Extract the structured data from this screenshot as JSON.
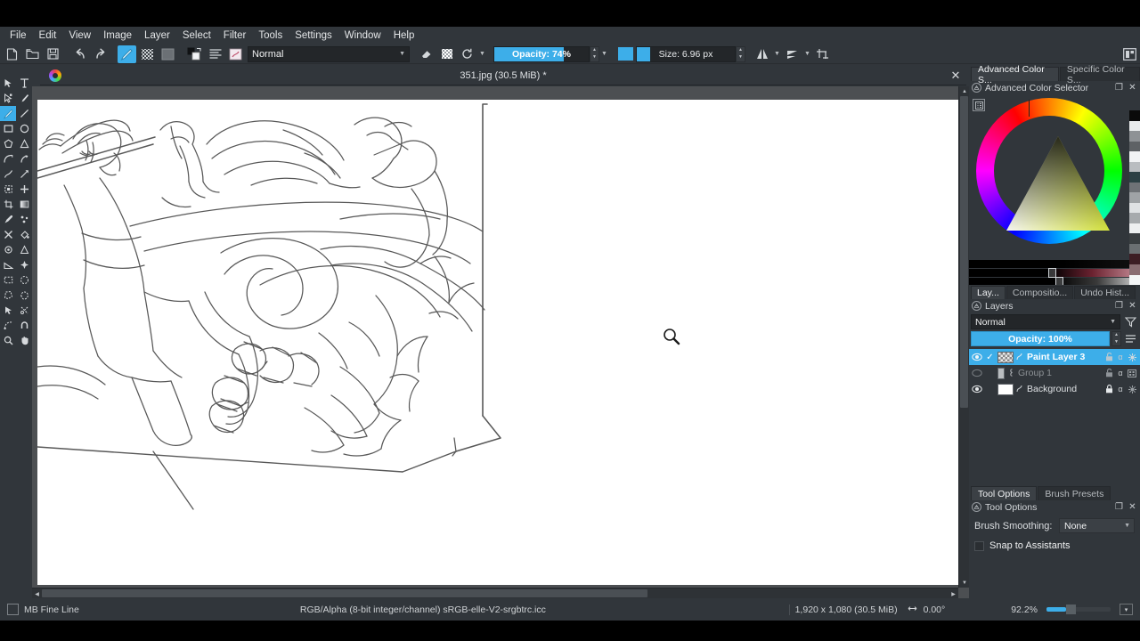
{
  "app": {
    "name": "Krita",
    "accent": "#3daee9",
    "chrome_bg": "#31363b"
  },
  "menubar": {
    "items": [
      "File",
      "Edit",
      "View",
      "Image",
      "Layer",
      "Select",
      "Filter",
      "Tools",
      "Settings",
      "Window",
      "Help"
    ]
  },
  "toolbar": {
    "new_label": "new-document",
    "open_label": "open-document",
    "save_label": "save-document",
    "undo_label": "undo",
    "redo_label": "redo",
    "blend_mode": "Normal",
    "opacity_label": "Opacity:  74%",
    "opacity_value": 74,
    "size_label": "Size: 6.96 px",
    "size_value": 6.96
  },
  "document": {
    "title": "351.jpg (30.5 MiB) *",
    "close_label": "✕"
  },
  "color_selector": {
    "tabs": [
      {
        "label": "Advanced Color S...",
        "active": true
      },
      {
        "label": "Specific Color S...",
        "active": false
      }
    ],
    "title": "Advanced Color Selector",
    "float_label": "❐",
    "close_label": "✕",
    "wheel_hue_deg": 75,
    "triangle_color": "#d9e838"
  },
  "layers_docker": {
    "tabs": [
      {
        "label": "Lay...",
        "active": true
      },
      {
        "label": "Compositio...",
        "active": false
      },
      {
        "label": "Undo Hist...",
        "active": false
      }
    ],
    "title": "Layers",
    "float_label": "❐",
    "close_label": "✕",
    "blend_mode": "Normal",
    "opacity_label": "Opacity:  100%",
    "opacity_value": 100,
    "rows": [
      {
        "name": "Paint Layer 3",
        "visible": true,
        "checked": true,
        "selected": true,
        "kind": "paint",
        "locked": false,
        "alpha_label": "α"
      },
      {
        "name": "Group 1",
        "visible": false,
        "checked": false,
        "selected": false,
        "kind": "group",
        "locked": false,
        "alpha_label": "α"
      },
      {
        "name": "Background",
        "visible": true,
        "checked": false,
        "selected": false,
        "kind": "paint",
        "locked": true,
        "alpha_label": "α"
      }
    ],
    "buttons": [
      "add-layer",
      "duplicate-layer",
      "move-layer-down",
      "move-layer-up",
      "layer-properties",
      "delete-layer"
    ]
  },
  "tool_options": {
    "tabs": [
      {
        "label": "Tool Options",
        "active": true
      },
      {
        "label": "Brush Presets",
        "active": false
      }
    ],
    "title": "Tool Options",
    "float_label": "❐",
    "close_label": "✕",
    "smoothing_label": "Brush Smoothing:",
    "smoothing_value": "None",
    "snap_label": "Snap to Assistants",
    "snap_checked": false
  },
  "statusbar": {
    "brush_preset": "MB Fine Line",
    "color_profile": "RGB/Alpha (8-bit integer/channel)  sRGB-elle-V2-srgbtrc.icc",
    "image_size": "1,920 x 1,080 (30.5 MiB)",
    "rotation": "0.00°",
    "zoom": "92.2%"
  },
  "toolbox": {
    "tools": [
      {
        "name": "select-shapes-tool",
        "selected": false
      },
      {
        "name": "text-tool",
        "selected": false
      },
      {
        "name": "edit-shapes-tool",
        "selected": false
      },
      {
        "name": "calligraphy-tool",
        "selected": false
      },
      {
        "name": "freehand-brush-tool",
        "selected": true
      },
      {
        "name": "line-tool",
        "selected": false
      },
      {
        "name": "rectangle-tool",
        "selected": false
      },
      {
        "name": "ellipse-tool",
        "selected": false
      },
      {
        "name": "polygon-tool",
        "selected": false
      },
      {
        "name": "polyline-tool",
        "selected": false
      },
      {
        "name": "bezier-curve-tool",
        "selected": false
      },
      {
        "name": "freehand-path-tool",
        "selected": false
      },
      {
        "name": "dynamic-brush-tool",
        "selected": false
      },
      {
        "name": "multibrush-tool",
        "selected": false
      },
      {
        "name": "transform-tool",
        "selected": false
      },
      {
        "name": "move-tool",
        "selected": false
      },
      {
        "name": "crop-tool",
        "selected": false
      },
      {
        "name": "gradient-tool",
        "selected": false
      },
      {
        "name": "color-picker-tool",
        "selected": false
      },
      {
        "name": "colorize-mask-tool",
        "selected": false
      },
      {
        "name": "smart-patch-tool",
        "selected": false
      },
      {
        "name": "fill-tool",
        "selected": false
      },
      {
        "name": "enclose-fill-tool",
        "selected": false
      },
      {
        "name": "gradient-edit-tool",
        "selected": false
      },
      {
        "name": "measure-tool",
        "selected": false
      },
      {
        "name": "assistant-tool",
        "selected": false
      },
      {
        "name": "rectangular-select-tool",
        "selected": false
      },
      {
        "name": "elliptical-select-tool",
        "selected": false
      },
      {
        "name": "polygonal-select-tool",
        "selected": false
      },
      {
        "name": "freehand-select-tool",
        "selected": false
      },
      {
        "name": "contiguous-select-tool",
        "selected": false
      },
      {
        "name": "similar-color-select-tool",
        "selected": false
      },
      {
        "name": "bezier-select-tool",
        "selected": false
      },
      {
        "name": "magnetic-select-tool",
        "selected": false
      },
      {
        "name": "zoom-tool",
        "selected": false
      },
      {
        "name": "pan-tool",
        "selected": false
      }
    ]
  },
  "canvas": {
    "cursor": "zoom-magnifier-cursor",
    "artwork_description": "pencil sketch of figure with staff, flowing ribbons and flames"
  }
}
